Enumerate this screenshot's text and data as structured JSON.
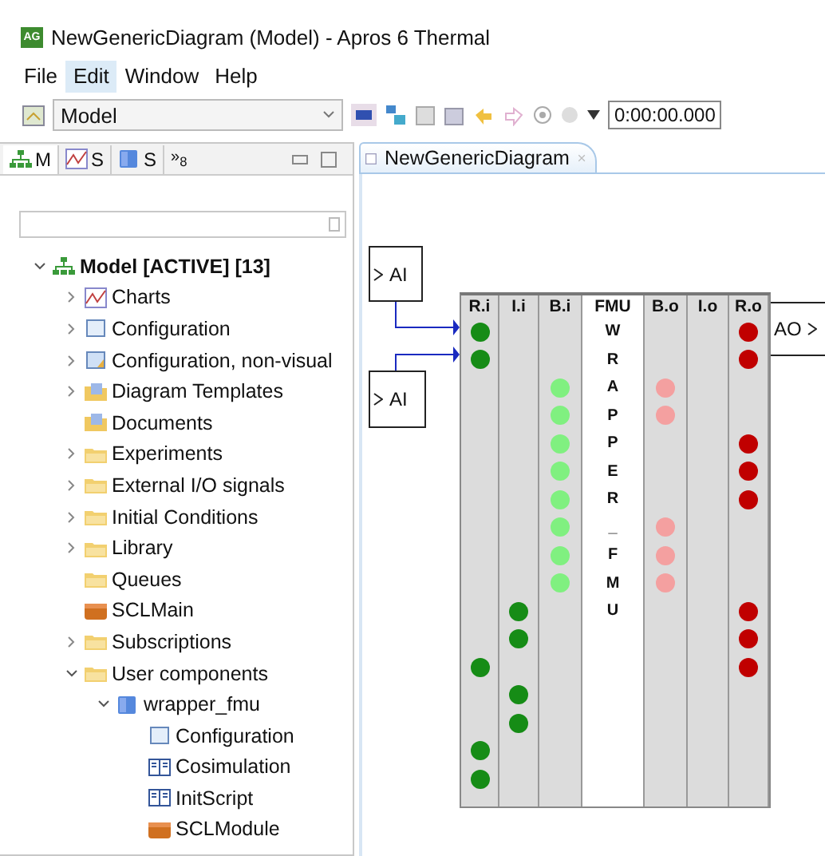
{
  "window": {
    "title": "NewGenericDiagram (Model) - Apros 6 Thermal",
    "app_icon": "AG"
  },
  "menu": [
    {
      "label": "File",
      "selected": false
    },
    {
      "label": "Edit",
      "selected": true
    },
    {
      "label": "Window",
      "selected": false
    },
    {
      "label": "Help",
      "selected": false
    }
  ],
  "toolbar": {
    "model_combo": "Model",
    "time": "0:00:00.000"
  },
  "left_panel": {
    "tabs": [
      {
        "label": "M",
        "kind": "tree",
        "selected": true
      },
      {
        "label": "S",
        "kind": "chart",
        "selected": false
      },
      {
        "label": "S",
        "kind": "globe",
        "selected": false
      }
    ],
    "overflow": "»$_{8}$",
    "tree": [
      {
        "label": "Model [ACTIVE] [13]",
        "kind": "model",
        "expanded": true,
        "children": [
          {
            "label": "Charts",
            "kind": "chart",
            "expanded": false
          },
          {
            "label": "Configuration",
            "kind": "config",
            "expanded": false
          },
          {
            "label": "Configuration, non-visual",
            "kind": "config-nv",
            "expanded": false
          },
          {
            "label": "Diagram Templates",
            "kind": "folder-doc",
            "expanded": false
          },
          {
            "label": "Documents",
            "kind": "folder-doc"
          },
          {
            "label": "Experiments",
            "kind": "folder",
            "expanded": false
          },
          {
            "label": "External I/O signals",
            "kind": "folder",
            "expanded": false
          },
          {
            "label": "Initial Conditions",
            "kind": "folder",
            "expanded": false
          },
          {
            "label": "Library",
            "kind": "folder",
            "expanded": false
          },
          {
            "label": "Queues",
            "kind": "folder"
          },
          {
            "label": "SCLMain",
            "kind": "scl"
          },
          {
            "label": "Subscriptions",
            "kind": "folder",
            "expanded": false
          },
          {
            "label": "User components",
            "kind": "folder",
            "expanded": true,
            "children": [
              {
                "label": "wrapper_fmu",
                "kind": "module",
                "expanded": true,
                "children": [
                  {
                    "label": "Configuration",
                    "kind": "config"
                  },
                  {
                    "label": "Cosimulation",
                    "kind": "book"
                  },
                  {
                    "label": "InitScript",
                    "kind": "book"
                  },
                  {
                    "label": "SCLModule",
                    "kind": "scl"
                  }
                ]
              }
            ]
          }
        ]
      }
    ]
  },
  "editor": {
    "tab": "NewGenericDiagram",
    "blocks": [
      {
        "label": "AI",
        "kind": "input"
      },
      {
        "label": "AI",
        "kind": "input"
      },
      {
        "label": "AO",
        "kind": "output"
      }
    ],
    "columns": [
      {
        "header": "R.i",
        "kind": "ports",
        "color": "#168c16",
        "slots": [
          true,
          true,
          false,
          false,
          false,
          false,
          false,
          false,
          false,
          false,
          false,
          false,
          true,
          false,
          false,
          true,
          true
        ]
      },
      {
        "header": "I.i",
        "kind": "ports",
        "color": "#168c16",
        "slots": [
          false,
          false,
          false,
          false,
          false,
          false,
          false,
          false,
          false,
          false,
          true,
          true,
          false,
          true,
          true,
          false,
          false
        ]
      },
      {
        "header": "B.i",
        "kind": "ports",
        "color": "#80f080",
        "slots": [
          false,
          false,
          true,
          true,
          true,
          true,
          true,
          true,
          true,
          true,
          false,
          false,
          false,
          false,
          false,
          false,
          false
        ]
      },
      {
        "header": "FMU",
        "kind": "name",
        "text": "WRAPPER_FMU"
      },
      {
        "header": "B.o",
        "kind": "ports",
        "color": "#f4a0a0",
        "slots": [
          false,
          false,
          true,
          true,
          false,
          false,
          false,
          true,
          true,
          true,
          false,
          false,
          false,
          false,
          false,
          false,
          false
        ]
      },
      {
        "header": "I.o",
        "kind": "empty"
      },
      {
        "header": "R.o",
        "kind": "ports",
        "color": "#c00000",
        "slots": [
          true,
          true,
          false,
          false,
          true,
          true,
          true,
          false,
          false,
          false,
          true,
          true,
          true,
          false,
          false,
          false,
          false
        ]
      }
    ]
  }
}
